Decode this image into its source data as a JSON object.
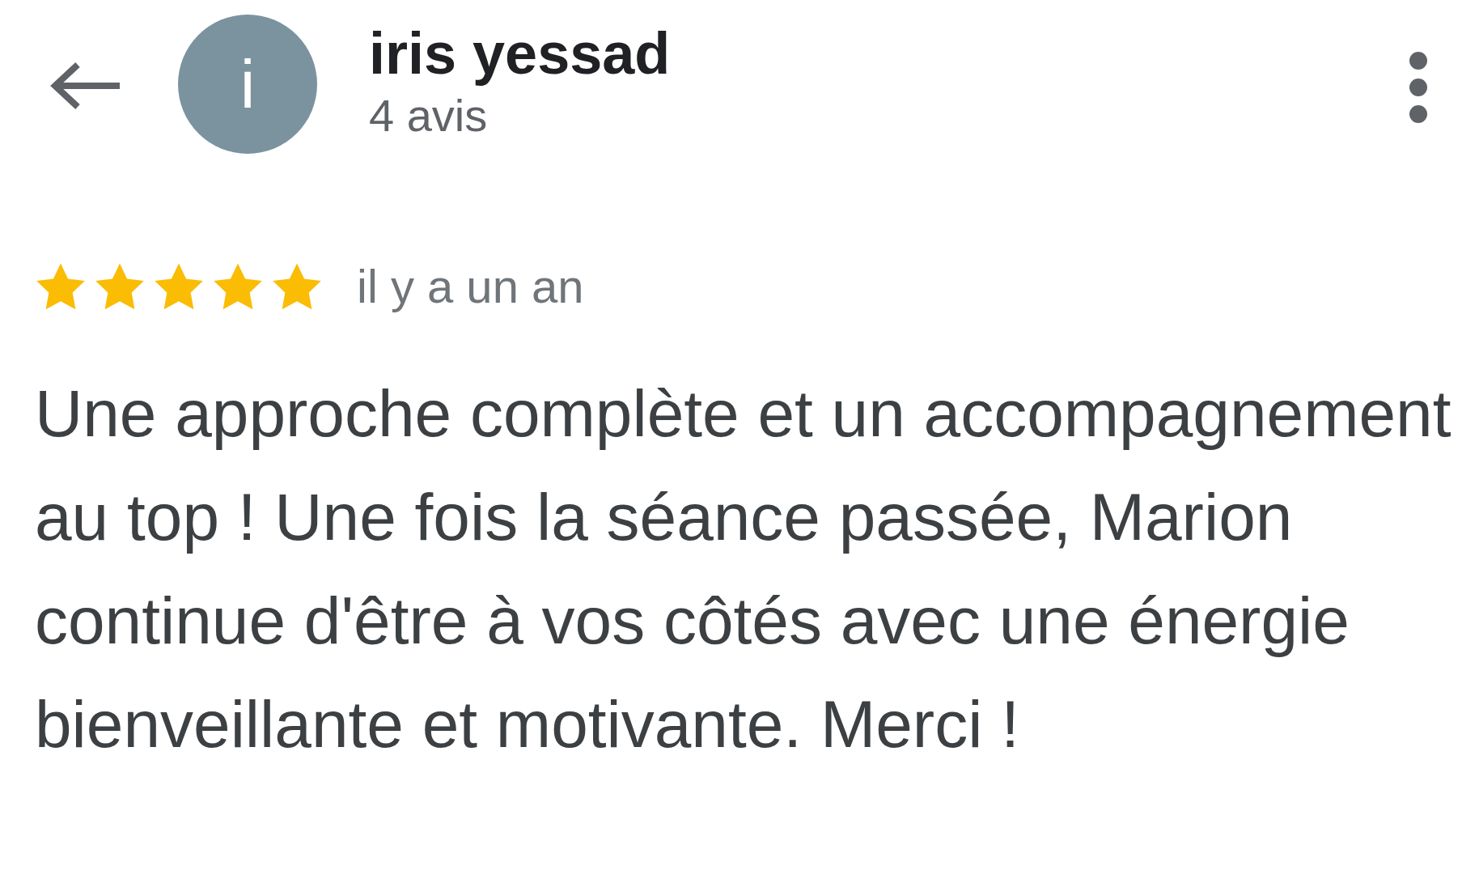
{
  "reviewer": {
    "avatar_letter": "i",
    "name": "iris yessad",
    "review_count": "4 avis"
  },
  "review": {
    "stars": 5,
    "time": "il y a un an",
    "text": "Une approche complète et un accompagnement au top ! Une fois la séance passée, Marion continue d'être à vos côtés avec une énergie bienveillante et motivante. Merci !"
  }
}
